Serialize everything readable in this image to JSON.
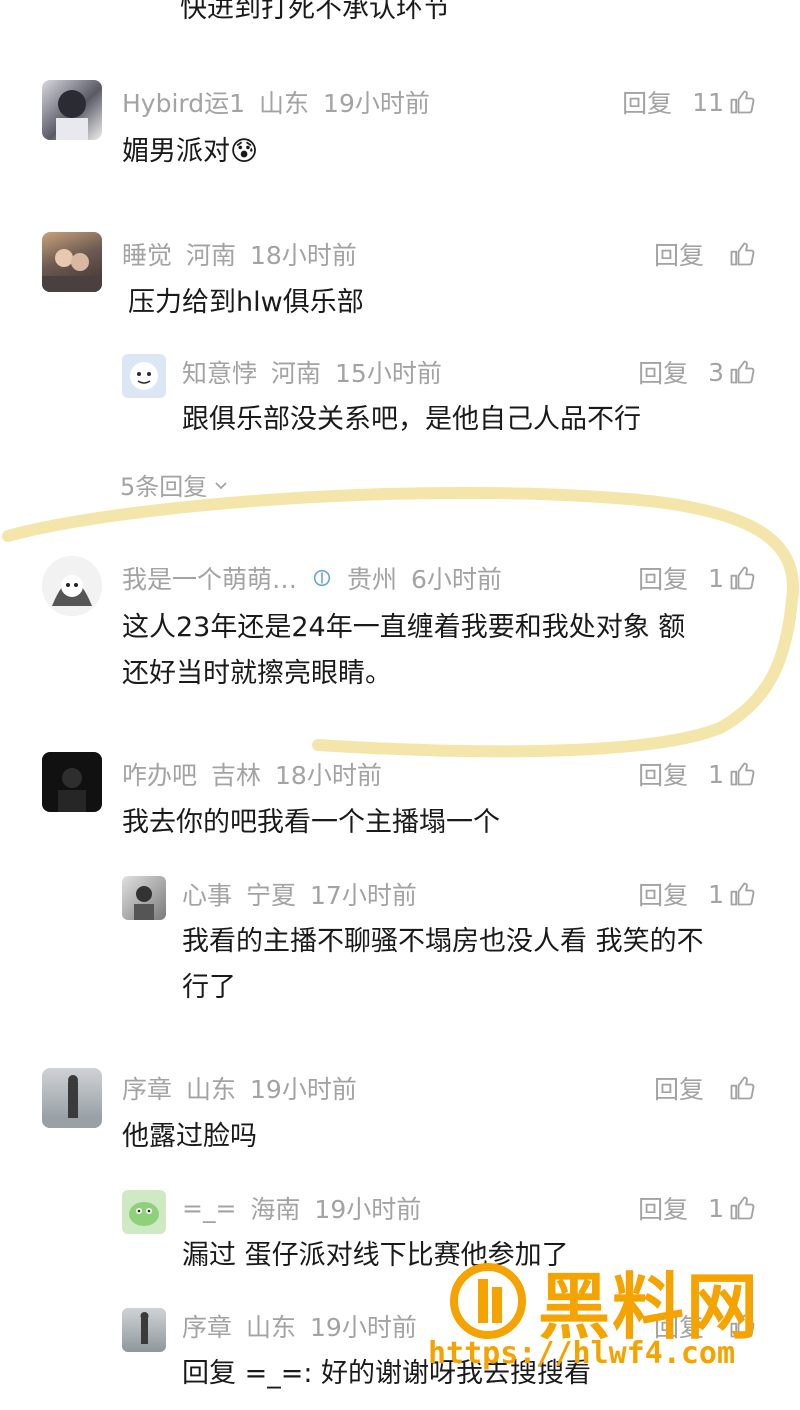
{
  "top_cut_text": "快进到打死不承认环节",
  "reply_label": "回复",
  "comments": [
    {
      "user": "Hybird运1",
      "location": "山东",
      "time": "19小时前",
      "likes": "11",
      "text": "媚男派对😰"
    },
    {
      "user": "睡觉",
      "location": "河南",
      "time": "18小时前",
      "likes": "",
      "text": "压力给到hlw俱乐部",
      "reply": {
        "user": "知意悖",
        "location": "河南",
        "time": "15小时前",
        "likes": "3",
        "text": "跟俱乐部没关系吧，是他自己人品不行"
      },
      "more": "5条回复"
    },
    {
      "user": "我是一个萌萌…",
      "location": "贵州",
      "time": "6小时前",
      "likes": "1",
      "text_line1": "这人23年还是24年一直缠着我要和我处对象 额",
      "text_line2": "还好当时就擦亮眼睛。"
    },
    {
      "user": "咋办吧",
      "location": "吉林",
      "time": "18小时前",
      "likes": "1",
      "text": "我去你的吧我看一个主播塌一个",
      "reply": {
        "user": "心事",
        "location": "宁夏",
        "time": "17小时前",
        "likes": "1",
        "text_line1": "我看的主播不聊骚不塌房也没人看 我笑的不",
        "text_line2": "行了"
      }
    },
    {
      "user": "序章",
      "location": "山东",
      "time": "19小时前",
      "likes": "",
      "text": "他露过脸吗",
      "reply": {
        "user": "=_=",
        "location": "海南",
        "time": "19小时前",
        "likes": "1",
        "text": "漏过 蛋仔派对线下比赛他参加了"
      },
      "reply2": {
        "user": "序章",
        "location": "山东",
        "time": "19小时前",
        "likes": "",
        "text": "回复 =_=: 好的谢谢呀我去搜搜看"
      }
    }
  ],
  "watermark": {
    "title": "黑料网",
    "url": "https://hlwf4.com"
  },
  "colors": {
    "meta": "#a3a3a3",
    "highlight": "#f3e3a2",
    "watermark": "#f4a300"
  }
}
